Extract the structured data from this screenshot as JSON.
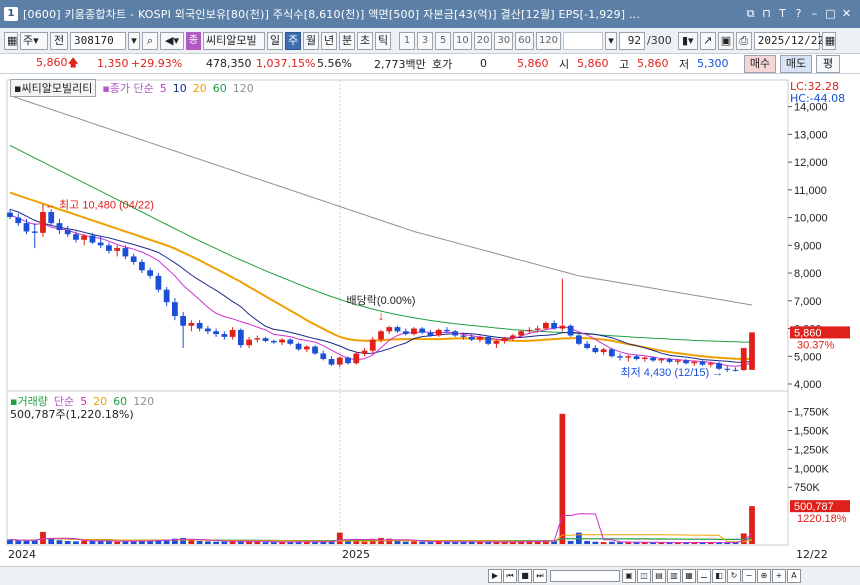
{
  "window": {
    "icon_label": "1",
    "title": "[0600] 키움종합차트 - KOSPI 외국인보유[80(천)] 주식수[8,610(천)] 액면[500] 자본금[43(억)] 결산[12월] EPS[-1,929] ..."
  },
  "toolbar": {
    "type_label": "주",
    "prev_label": "전",
    "code": "308170",
    "stock_badge": "종",
    "stock_name": "씨티알모빌",
    "periods": [
      "일",
      "주",
      "월",
      "년",
      "분",
      "초",
      "틱"
    ],
    "selected_period": "주",
    "intervals": [
      "1",
      "3",
      "5",
      "10",
      "20",
      "30",
      "60",
      "120"
    ],
    "count": "92",
    "count_total": "/300",
    "date": "2025/12/22"
  },
  "quote": {
    "price": "5,860",
    "change": "1,350",
    "change_pct": "+29.93%",
    "volume": "478,350",
    "volume_pct": "1,037.15%",
    "turnover": "5.56%",
    "amount": "2,773백만",
    "bid_label": "호가",
    "bid_value": "0",
    "last": "5,860",
    "open_label": "시",
    "open": "5,860",
    "high_label": "고",
    "high": "5,860",
    "low_label": "저",
    "low": "5,300",
    "buy_label": "매수",
    "sell_label": "매도",
    "avg_label": "평"
  },
  "price_pane": {
    "name": "씨티알모빌리티",
    "ma_legend": "종가 단순",
    "ma_periods": [
      "5",
      "10",
      "20",
      "60",
      "120"
    ],
    "lc_label": "LC:32.28",
    "hc_label": "HC:-44.08",
    "axis": [
      "14,000",
      "13,000",
      "12,000",
      "11,000",
      "10,000",
      "9,000",
      "8,000",
      "7,000",
      "6,000",
      "5,000",
      "4,000"
    ],
    "current_label": "5,860",
    "current_pct": "30.37%",
    "high_note": "최고 10,480 (04/22)",
    "low_note": "최저 4,430 (12/15)",
    "dividend_note": "배당락(0.00%)"
  },
  "volume_pane": {
    "title": "거래량",
    "ma_legend": "단순",
    "ma_periods": [
      "5",
      "20",
      "60",
      "120"
    ],
    "stat": "500,787주(1,220.18%)",
    "axis": [
      "1,750K",
      "1,500K",
      "1,250K",
      "1,000K",
      "750K"
    ],
    "current_label": "500,787",
    "current_pct": "1220.18%"
  },
  "x_axis": {
    "labels": [
      "2024",
      "2025"
    ],
    "right_label": "12/22"
  },
  "colors": {
    "up": "#e0201a",
    "down": "#1a4fd6",
    "ma5": "#d030d0",
    "ma10": "#1a2a8a",
    "ma20": "#f0a000",
    "ma60": "#20a040",
    "ma120": "#909090"
  },
  "chart_data": {
    "type": "candlestick",
    "ylim": [
      4000,
      14600
    ],
    "candles": [
      [
        10180,
        10300,
        9950,
        10020
      ],
      [
        10000,
        10150,
        9700,
        9800
      ],
      [
        9800,
        9950,
        9400,
        9500
      ],
      [
        9500,
        9800,
        8900,
        9450
      ],
      [
        9450,
        10480,
        9300,
        10200
      ],
      [
        10200,
        10300,
        9700,
        9800
      ],
      [
        9800,
        9950,
        9400,
        9550
      ],
      [
        9550,
        9700,
        9300,
        9400
      ],
      [
        9400,
        9500,
        9100,
        9200
      ],
      [
        9200,
        9400,
        9000,
        9350
      ],
      [
        9350,
        9450,
        9050,
        9100
      ],
      [
        9100,
        9300,
        8900,
        9000
      ],
      [
        9000,
        9100,
        8700,
        8800
      ],
      [
        8800,
        9000,
        8600,
        8900
      ],
      [
        8900,
        9000,
        8500,
        8600
      ],
      [
        8600,
        8700,
        8300,
        8400
      ],
      [
        8400,
        8500,
        8000,
        8100
      ],
      [
        8100,
        8200,
        7800,
        7900
      ],
      [
        7900,
        8000,
        7300,
        7400
      ],
      [
        7400,
        7500,
        6800,
        6950
      ],
      [
        6950,
        7100,
        6300,
        6450
      ],
      [
        6450,
        6600,
        5300,
        6100
      ],
      [
        6100,
        6300,
        5900,
        6200
      ],
      [
        6200,
        6300,
        5900,
        6000
      ],
      [
        6000,
        6100,
        5800,
        5900
      ],
      [
        5900,
        6000,
        5700,
        5800
      ],
      [
        5800,
        5900,
        5600,
        5700
      ],
      [
        5700,
        6050,
        5600,
        5950
      ],
      [
        5950,
        6000,
        5300,
        5400
      ],
      [
        5400,
        5700,
        5300,
        5600
      ],
      [
        5600,
        5750,
        5500,
        5650
      ],
      [
        5650,
        5700,
        5500,
        5550
      ],
      [
        5550,
        5600,
        5450,
        5500
      ],
      [
        5500,
        5650,
        5400,
        5600
      ],
      [
        5600,
        5650,
        5400,
        5450
      ],
      [
        5450,
        5500,
        5200,
        5250
      ],
      [
        5250,
        5400,
        5150,
        5350
      ],
      [
        5350,
        5400,
        5050,
        5100
      ],
      [
        5100,
        5200,
        4850,
        4900
      ],
      [
        4900,
        5000,
        4650,
        4700
      ],
      [
        4700,
        5000,
        4600,
        4950
      ],
      [
        4950,
        5000,
        4700,
        4750
      ],
      [
        4750,
        5150,
        4700,
        5100
      ],
      [
        5100,
        5300,
        5000,
        5200
      ],
      [
        5200,
        5700,
        5100,
        5600
      ],
      [
        5600,
        5950,
        5500,
        5900
      ],
      [
        5900,
        6100,
        5800,
        6050
      ],
      [
        6050,
        6100,
        5850,
        5900
      ],
      [
        5900,
        6000,
        5750,
        5800
      ],
      [
        5800,
        6050,
        5750,
        6000
      ],
      [
        6000,
        6050,
        5800,
        5850
      ],
      [
        5850,
        5950,
        5700,
        5750
      ],
      [
        5750,
        6000,
        5700,
        5950
      ],
      [
        5950,
        6050,
        5850,
        5900
      ],
      [
        5900,
        5950,
        5700,
        5750
      ],
      [
        5750,
        5850,
        5600,
        5700
      ],
      [
        5700,
        5800,
        5550,
        5600
      ],
      [
        5600,
        5750,
        5500,
        5700
      ],
      [
        5700,
        5750,
        5400,
        5450
      ],
      [
        5450,
        5600,
        5300,
        5550
      ],
      [
        5550,
        5700,
        5450,
        5650
      ],
      [
        5650,
        5800,
        5550,
        5750
      ],
      [
        5750,
        5950,
        5650,
        5900
      ],
      [
        5900,
        6050,
        5800,
        5950
      ],
      [
        5950,
        6100,
        5850,
        6000
      ],
      [
        6000,
        6250,
        5950,
        6200
      ],
      [
        6200,
        6300,
        5950,
        6000
      ],
      [
        6000,
        7800,
        5900,
        6100
      ],
      [
        6100,
        6150,
        5700,
        5750
      ],
      [
        5750,
        5800,
        5400,
        5450
      ],
      [
        5450,
        5550,
        5250,
        5300
      ],
      [
        5300,
        5400,
        5100,
        5150
      ],
      [
        5150,
        5300,
        5050,
        5250
      ],
      [
        5250,
        5300,
        4950,
        5000
      ],
      [
        5000,
        5100,
        4850,
        4950
      ],
      [
        4950,
        5050,
        4800,
        5000
      ],
      [
        5000,
        5050,
        4850,
        4900
      ],
      [
        4900,
        5000,
        4800,
        4950
      ],
      [
        4950,
        5000,
        4800,
        4850
      ],
      [
        4850,
        4950,
        4750,
        4900
      ],
      [
        4900,
        4950,
        4750,
        4800
      ],
      [
        4800,
        4900,
        4700,
        4850
      ],
      [
        4850,
        4900,
        4700,
        4750
      ],
      [
        4750,
        4850,
        4650,
        4800
      ],
      [
        4800,
        4850,
        4650,
        4700
      ],
      [
        4700,
        4800,
        4600,
        4750
      ],
      [
        4750,
        4800,
        4500,
        4550
      ],
      [
        4550,
        4650,
        4430,
        4510
      ],
      [
        4510,
        4600,
        4450,
        4500
      ],
      [
        4500,
        5300,
        4480,
        5300
      ],
      [
        4510,
        5860,
        4500,
        5860
      ]
    ],
    "volumes": [
      60,
      45,
      40,
      55,
      160,
      70,
      50,
      40,
      35,
      45,
      40,
      35,
      40,
      30,
      35,
      40,
      45,
      50,
      55,
      60,
      70,
      80,
      50,
      40,
      35,
      30,
      30,
      45,
      40,
      30,
      30,
      25,
      25,
      30,
      30,
      30,
      30,
      25,
      40,
      35,
      150,
      40,
      40,
      30,
      60,
      80,
      70,
      40,
      30,
      35,
      30,
      25,
      40,
      30,
      25,
      30,
      30,
      25,
      30,
      25,
      25,
      30,
      40,
      40,
      30,
      50,
      40,
      1720,
      40,
      150,
      40,
      30,
      25,
      30,
      25,
      20,
      25,
      20,
      20,
      20,
      20,
      20,
      20,
      20,
      20,
      20,
      20,
      20,
      20,
      140,
      500
    ],
    "ma": {
      "ma5": [
        10100,
        9980,
        9850,
        9750,
        9794,
        9650,
        9600,
        9550,
        9440,
        9360,
        9290,
        9250,
        9150,
        9030,
        8940,
        8860,
        8760,
        8620,
        8450,
        8170,
        7900,
        7560,
        7300,
        7040,
        6760,
        6550,
        6430,
        6350,
        6250,
        6160,
        6050,
        5950,
        5790,
        5750,
        5710,
        5620,
        5570,
        5510,
        5380,
        5220,
        5060,
        4920,
        4880,
        4910,
        5050,
        5300,
        5580,
        5750,
        5850,
        5850,
        5880,
        5860,
        5850,
        5860,
        5850,
        5790,
        5740,
        5690,
        5660,
        5620,
        5580,
        5640,
        5730,
        5830,
        5890,
        5960,
        6010,
        6070,
        6010,
        5880,
        5770,
        5610,
        5430,
        5260,
        5160,
        5080,
        5050,
        5020,
        4970,
        4920,
        4900,
        4880,
        4850,
        4830,
        4810,
        4780,
        4730,
        4660,
        4640,
        4670,
        4780
      ],
      "ma10": [
        10300,
        10200,
        10050,
        9900,
        9800,
        9720,
        9650,
        9600,
        9540,
        9470,
        9390,
        9330,
        9270,
        9190,
        9110,
        9030,
        8940,
        8850,
        8740,
        8560,
        8370,
        8160,
        7930,
        7740,
        7550,
        7380,
        7180,
        6970,
        6790,
        6510,
        6290,
        6080,
        5970,
        5930,
        5860,
        5790,
        5710,
        5630,
        5570,
        5480,
        5370,
        5240,
        5150,
        5100,
        5110,
        5180,
        5270,
        5380,
        5480,
        5640,
        5710,
        5740,
        5770,
        5800,
        5810,
        5830,
        5810,
        5780,
        5730,
        5690,
        5660,
        5660,
        5680,
        5710,
        5740,
        5760,
        5780,
        5850,
        5870,
        5840,
        5820,
        5790,
        5730,
        5670,
        5560,
        5450,
        5380,
        5300,
        5210,
        5110,
        5040,
        5000,
        4970,
        4930,
        4880,
        4860,
        4840,
        4820,
        4790,
        4780,
        4820
      ],
      "ma20": [
        10900,
        10800,
        10700,
        10600,
        10500,
        10400,
        10300,
        10200,
        10100,
        10000,
        9900,
        9800,
        9700,
        9600,
        9500,
        9400,
        9300,
        9200,
        9100,
        9000,
        8880,
        8740,
        8600,
        8460,
        8300,
        8150,
        8000,
        7840,
        7680,
        7500,
        7330,
        7160,
        6990,
        6820,
        6650,
        6480,
        6300,
        6140,
        5990,
        5840,
        5700,
        5620,
        5580,
        5560,
        5560,
        5580,
        5600,
        5610,
        5620,
        5620,
        5620,
        5620,
        5620,
        5630,
        5640,
        5650,
        5640,
        5630,
        5620,
        5600,
        5580,
        5560,
        5550,
        5560,
        5580,
        5600,
        5620,
        5640,
        5650,
        5660,
        5650,
        5630,
        5600,
        5560,
        5500,
        5440,
        5380,
        5320,
        5260,
        5200,
        5150,
        5110,
        5070,
        5030,
        5000,
        4970,
        4950,
        4930,
        4910,
        4900,
        4910
      ],
      "ma60": [
        12600,
        12450,
        12300,
        12150,
        12000,
        11850,
        11700,
        11550,
        11400,
        11250,
        11100,
        10950,
        10800,
        10650,
        10500,
        10350,
        10200,
        10050,
        9900,
        9750,
        9600,
        9450,
        9300,
        9160,
        9020,
        8880,
        8740,
        8600,
        8470,
        8340,
        8210,
        8080,
        7960,
        7840,
        7720,
        7600,
        7480,
        7370,
        7260,
        7150,
        7050,
        6950,
        6860,
        6780,
        6700,
        6630,
        6560,
        6500,
        6440,
        6390,
        6340,
        6290,
        6250,
        6210,
        6170,
        6140,
        6110,
        6080,
        6050,
        6020,
        5990,
        5960,
        5940,
        5920,
        5900,
        5890,
        5870,
        5860,
        5840,
        5820,
        5800,
        5780,
        5760,
        5740,
        5720,
        5700,
        5680,
        5670,
        5650,
        5640,
        5620,
        5600,
        5590,
        5570,
        5560,
        5550,
        5540,
        5530,
        5520,
        5510,
        5510
      ],
      "ma120": [
        14400,
        14300,
        14200,
        14100,
        14000,
        13900,
        13800,
        13700,
        13600,
        13500,
        13400,
        13300,
        13200,
        13100,
        13000,
        12900,
        12800,
        12700,
        12600,
        12500,
        12400,
        12300,
        12200,
        12100,
        12000,
        11900,
        11800,
        11700,
        11600,
        11500,
        11400,
        11300,
        11200,
        11100,
        11000,
        10900,
        10800,
        10700,
        10600,
        10500,
        10400,
        10300,
        10200,
        10100,
        10000,
        9900,
        9800,
        9700,
        9600,
        9500,
        9420,
        9340,
        9260,
        9180,
        9100,
        9020,
        8940,
        8860,
        8780,
        8700,
        8620,
        8540,
        8460,
        8380,
        8300,
        8220,
        8140,
        8060,
        7980,
        7900,
        7850,
        7800,
        7750,
        7700,
        7650,
        7600,
        7550,
        7500,
        7450,
        7400,
        7350,
        7300,
        7250,
        7200,
        7150,
        7100,
        7050,
        7000,
        6950,
        6900,
        6850
      ]
    },
    "vol_ylim": [
      0,
      1850
    ]
  }
}
